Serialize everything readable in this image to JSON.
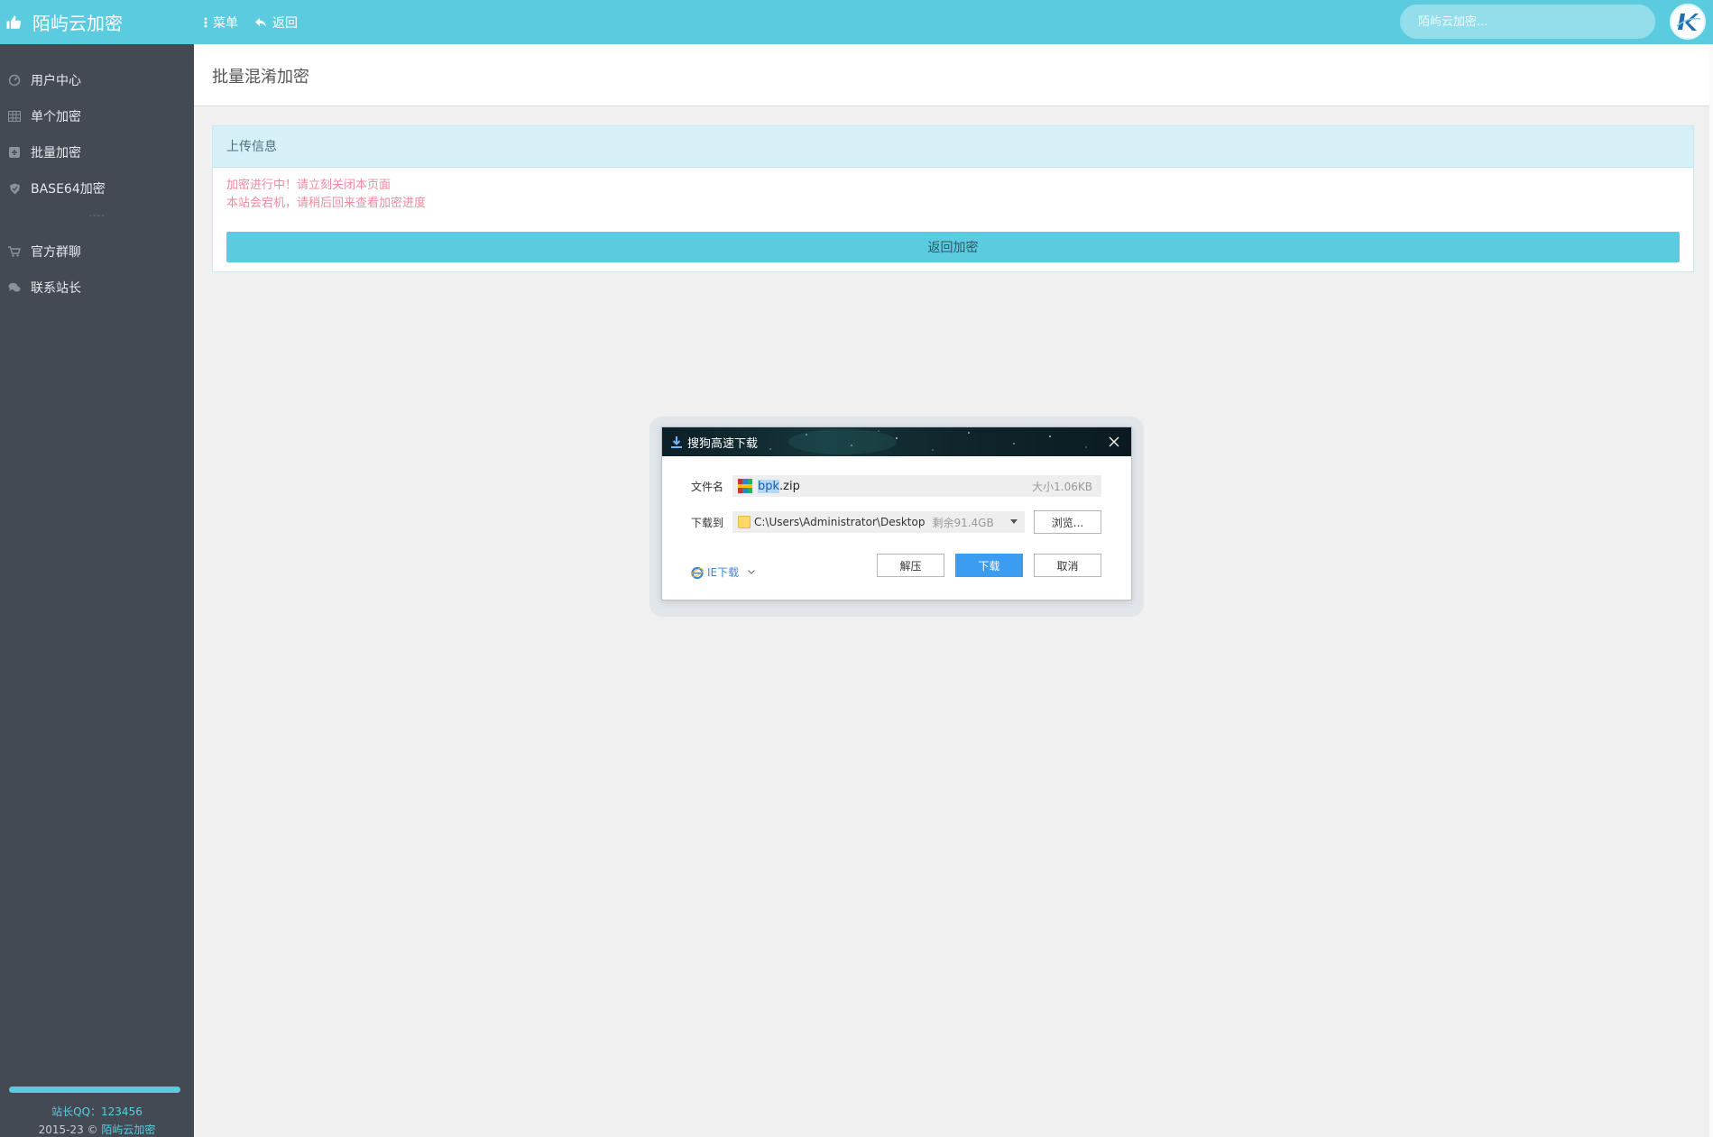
{
  "header": {
    "brand": "陌屿云加密",
    "menu_label": "菜单",
    "back_label": "返回",
    "search_placeholder": "陌屿云加密..."
  },
  "sidebar": {
    "items": [
      {
        "label": "用户中心",
        "icon": "dashboard-icon"
      },
      {
        "label": "单个加密",
        "icon": "grid-icon"
      },
      {
        "label": "批量加密",
        "icon": "plus-square-icon"
      },
      {
        "label": "BASE64加密",
        "icon": "shield-icon"
      },
      {
        "label": "官方群聊",
        "icon": "cart-icon"
      },
      {
        "label": "联系站长",
        "icon": "chat-icon"
      }
    ],
    "separator": "----",
    "footer": {
      "qq": "站长QQ：123456",
      "copyright_prefix": "2015-23 ©",
      "copyright_link": "陌屿云加密"
    }
  },
  "page": {
    "title": "批量混淆加密",
    "panel_title": "上传信息",
    "warning_line1": "加密进行中！请立刻关闭本页面",
    "warning_line2": "本站会宕机，请稍后回来查看加密进度",
    "return_button": "返回加密"
  },
  "dialog": {
    "title": "搜狗高速下载",
    "filename_label": "文件名",
    "filename_selected": "bpk",
    "filename_rest": ".zip",
    "file_size": "大小1.06KB",
    "download_to_label": "下载到",
    "path": "C:\\Users\\Administrator\\Desktop",
    "free_space": "剩余91.4GB",
    "browse_button": "浏览...",
    "ie_download": "IE下载",
    "extract_button": "解压",
    "download_button": "下载",
    "cancel_button": "取消"
  },
  "colors": {
    "accent": "#5bcce0",
    "sidebar_bg": "#434a54",
    "warning": "#f08aa0",
    "primary_button": "#3c9cf0"
  }
}
